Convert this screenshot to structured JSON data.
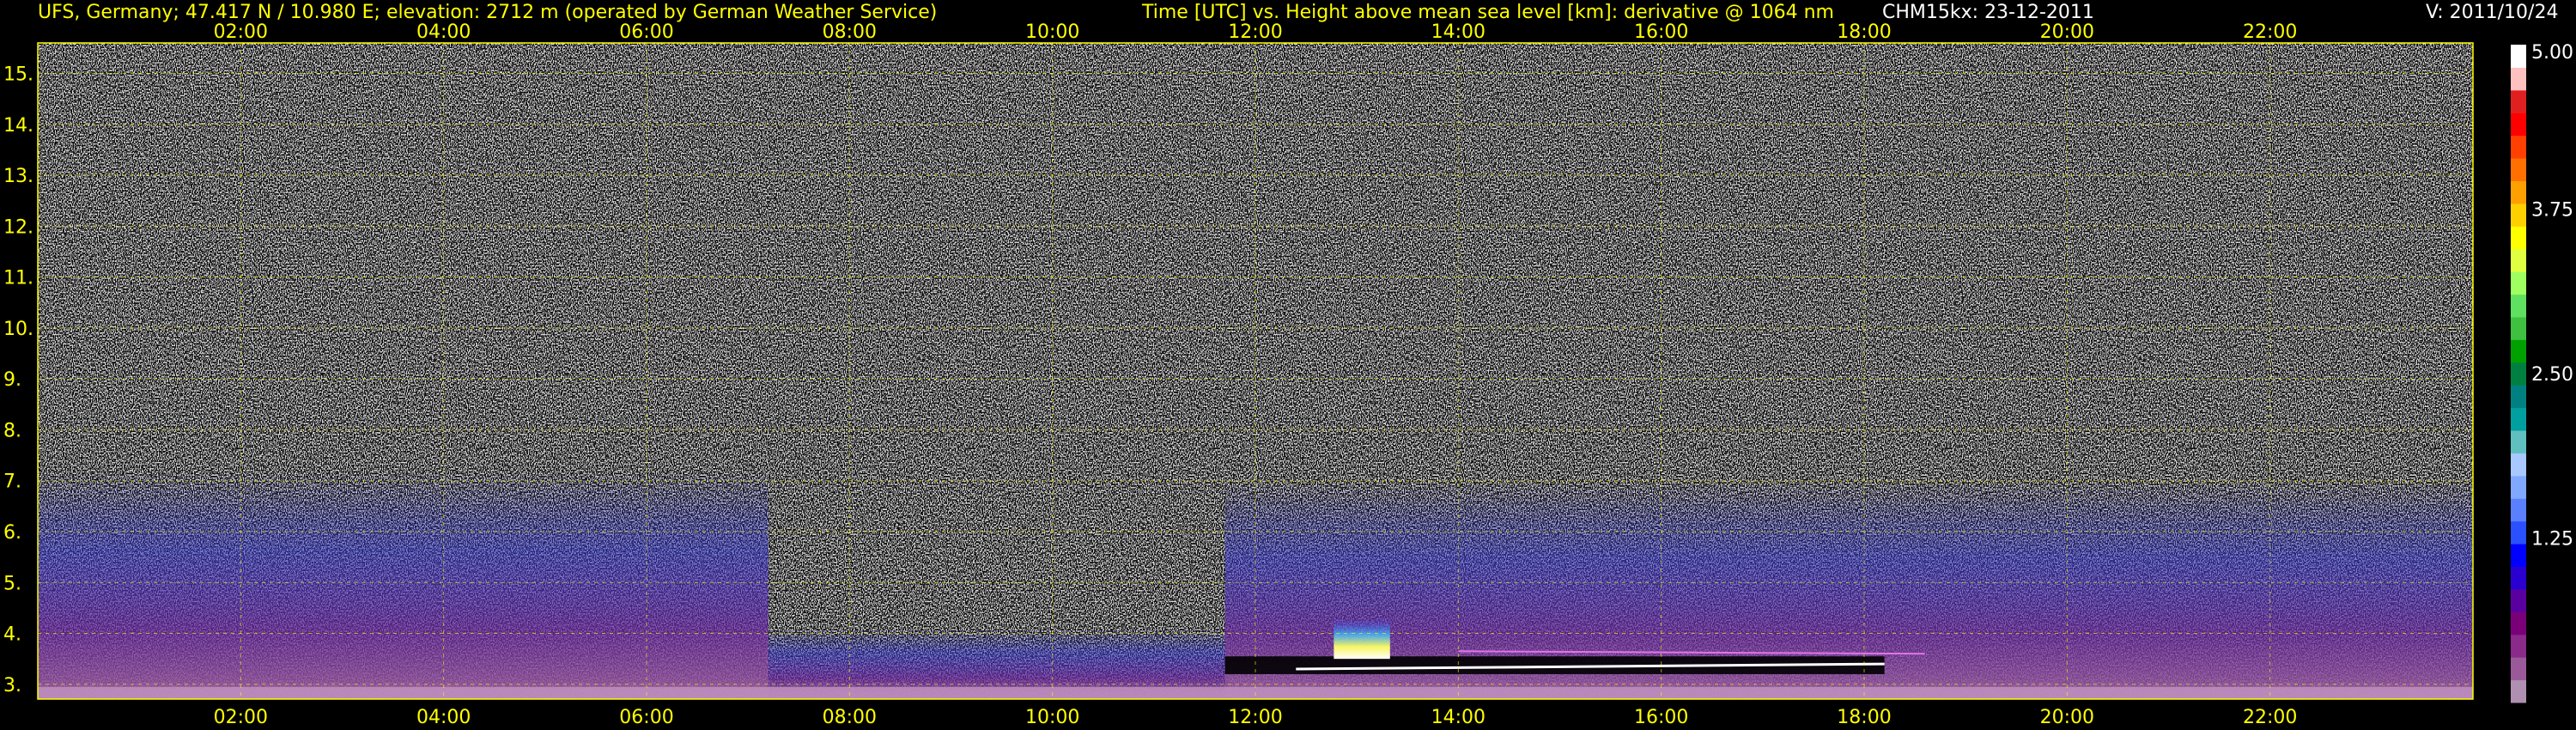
{
  "header": {
    "station": "UFS, Germany; 47.417 N / 10.980 E; elevation: 2712 m  (operated by German Weather Service)",
    "description": "Time [UTC] vs. Height above mean sea level [km]: derivative @ 1064 nm",
    "instrument": "CHM15kx: 23-12-2011",
    "version": "V: 2011/10/24"
  },
  "chart_data": {
    "type": "heatmap",
    "x_tick_labels": [
      "02:00",
      "04:00",
      "06:00",
      "08:00",
      "10:00",
      "12:00",
      "14:00",
      "16:00",
      "18:00",
      "20:00",
      "22:00"
    ],
    "x_tick_hours": [
      2,
      4,
      6,
      8,
      10,
      12,
      14,
      16,
      18,
      20,
      22
    ],
    "xlim": [
      0,
      24
    ],
    "y_tick_labels": [
      "3.",
      "4.",
      "5.",
      "6.",
      "7.",
      "8.",
      "9.",
      "10.",
      "11.",
      "12.",
      "13.",
      "14.",
      "15."
    ],
    "y_tick_values": [
      3,
      4,
      5,
      6,
      7,
      8,
      9,
      10,
      11,
      12,
      13,
      14,
      15
    ],
    "ylim": [
      2.71,
      15.6
    ],
    "grid": true,
    "colorbar": {
      "tick_labels": [
        "5.00",
        "3.75",
        "2.50",
        "1.25"
      ],
      "tick_values": [
        5.0,
        3.75,
        2.5,
        1.25
      ],
      "range": [
        0,
        5.0
      ],
      "colors": [
        "#b090b0",
        "#9a5a9a",
        "#8a2a8a",
        "#7a007a",
        "#5a00a0",
        "#2a00d0",
        "#0000ff",
        "#2a50ff",
        "#5a80ff",
        "#80a8ff",
        "#a8c8ff",
        "#60c0c0",
        "#00a0a0",
        "#008080",
        "#008040",
        "#00a000",
        "#40c040",
        "#60e060",
        "#a0ff60",
        "#e0ff40",
        "#ffff00",
        "#ffd000",
        "#ffa000",
        "#ff7000",
        "#ff4000",
        "#ff0000",
        "#e02020",
        "#ffc0c0",
        "#ffffff"
      ]
    },
    "features": {
      "cloud_base_km": 3.55,
      "bright_core_hours": [
        12.9,
        13.2
      ],
      "layer_time_hours": [
        11.7,
        18.2
      ]
    }
  }
}
